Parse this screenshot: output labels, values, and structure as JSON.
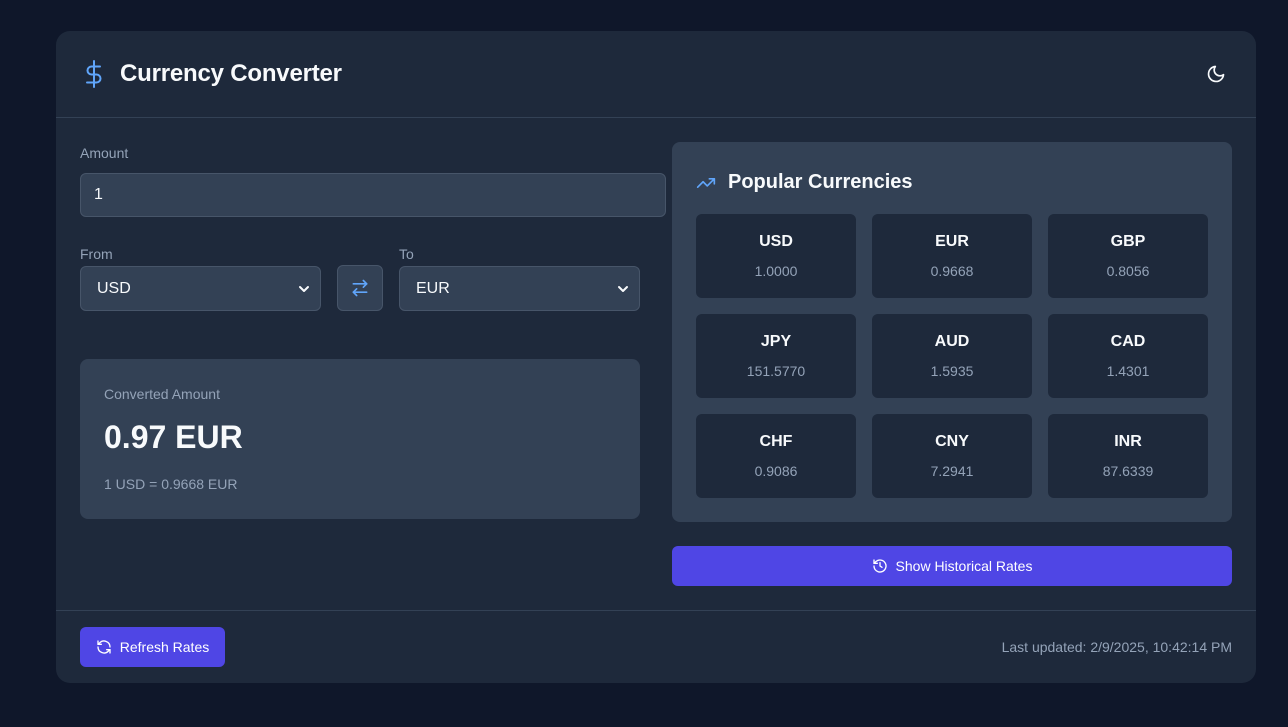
{
  "header": {
    "title": "Currency Converter",
    "logo_icon": "dollar-sign-icon",
    "theme_icon": "moon-icon"
  },
  "form": {
    "amount_label": "Amount",
    "amount_value": "1",
    "from_label": "From",
    "from_value": "USD",
    "to_label": "To",
    "to_value": "EUR",
    "swap_icon": "swap-arrows-icon"
  },
  "result": {
    "label": "Converted Amount",
    "value": "0.97 EUR",
    "rate_text": "1 USD = 0.9668 EUR"
  },
  "popular": {
    "title": "Popular Currencies",
    "icon": "trending-up-icon",
    "items": [
      {
        "code": "USD",
        "rate": "1.0000"
      },
      {
        "code": "EUR",
        "rate": "0.9668"
      },
      {
        "code": "GBP",
        "rate": "0.8056"
      },
      {
        "code": "JPY",
        "rate": "151.5770"
      },
      {
        "code": "AUD",
        "rate": "1.5935"
      },
      {
        "code": "CAD",
        "rate": "1.4301"
      },
      {
        "code": "CHF",
        "rate": "0.9086"
      },
      {
        "code": "CNY",
        "rate": "7.2941"
      },
      {
        "code": "INR",
        "rate": "87.6339"
      }
    ]
  },
  "actions": {
    "history_label": "Show Historical Rates",
    "history_icon": "history-icon",
    "refresh_label": "Refresh Rates",
    "refresh_icon": "refresh-icon"
  },
  "footer": {
    "last_updated": "Last updated: 2/9/2025, 10:42:14 PM"
  },
  "colors": {
    "background": "#0f172a",
    "card": "#1e293b",
    "panel": "#334155",
    "accent": "#4f46e5",
    "icon_blue": "#60a5fa",
    "muted_text": "#94a3b8"
  }
}
